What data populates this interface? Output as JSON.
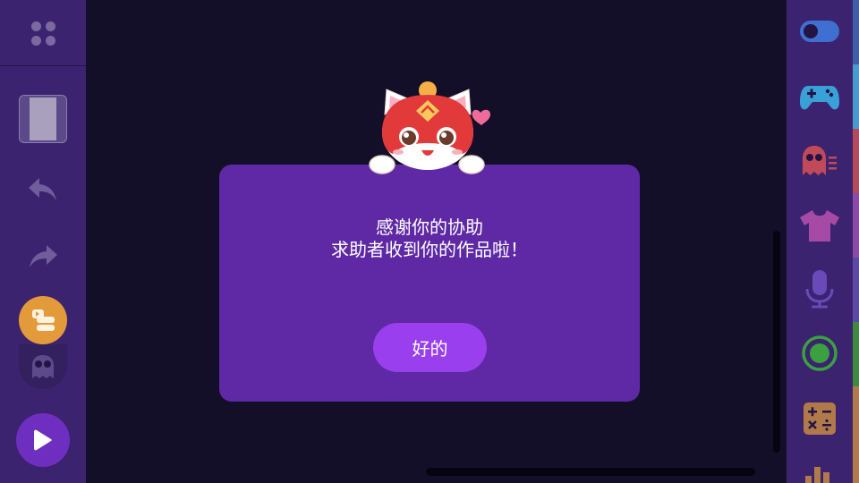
{
  "dialog": {
    "line1": "感谢你的协助",
    "line2": "求助者收到你的作品啦！",
    "ok_label": "好的"
  },
  "left_toolbar": {
    "items": [
      "apps-icon",
      "stage-thumbnail",
      "undo-icon",
      "redo-icon",
      "blocks-icon",
      "sprite-ghost-icon",
      "play-icon"
    ]
  },
  "right_toolbar": {
    "categories": [
      "toggle-icon",
      "gamepad-icon",
      "ghost-icon",
      "shirt-icon",
      "microphone-icon",
      "record-icon",
      "math-icon",
      "chart-icon"
    ],
    "strip_colors": [
      "#3f5da8",
      "#4a9ad0",
      "#b44a5a",
      "#8a4aa6",
      "#5a4aa6",
      "#3f8a3f",
      "#b07a4a"
    ]
  },
  "colors": {
    "sidebar": "#3b236f",
    "dialog": "#5f29a6",
    "button": "#9a3fee",
    "accent_orange": "#e39a3a"
  }
}
